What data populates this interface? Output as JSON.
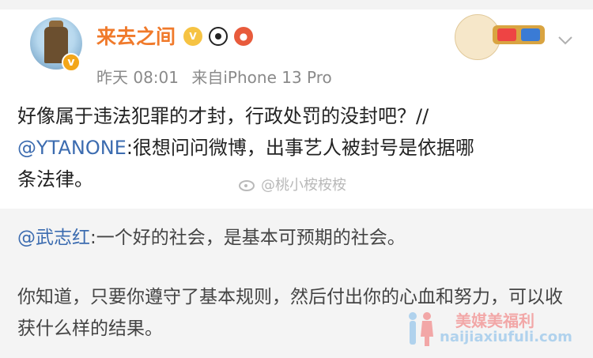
{
  "post": {
    "username": "来去之间",
    "badges": [
      "vip-badge",
      "panda-badge",
      "crab-badge"
    ],
    "time": "昨天 08:01",
    "source": "来自iPhone 13 Pro",
    "text_line1": "好像属于违法犯罪的才封，行政处罚的没封吧？//",
    "mention1": "@YTANONE",
    "text_line2_rest": ":很想问问微博，出事艺人被封号是依据哪",
    "text_line3": "条法律。",
    "watermark": "@桃小桉桉桉"
  },
  "retweet": {
    "mention": "@武志红",
    "line1_rest": ":一个好的社会，是基本可预期的社会。",
    "para": "你知道，只要你遵守了基本规则，然后付出你的心血和努力，可以收获什么样的结果。"
  },
  "site_watermark": {
    "cn": "美媒美福利",
    "url": "naijiaxiufuli.com"
  },
  "colors": {
    "username": "#f07a2b",
    "mention": "#3c6cb0",
    "retweet_bg": "#f4f4f4"
  }
}
